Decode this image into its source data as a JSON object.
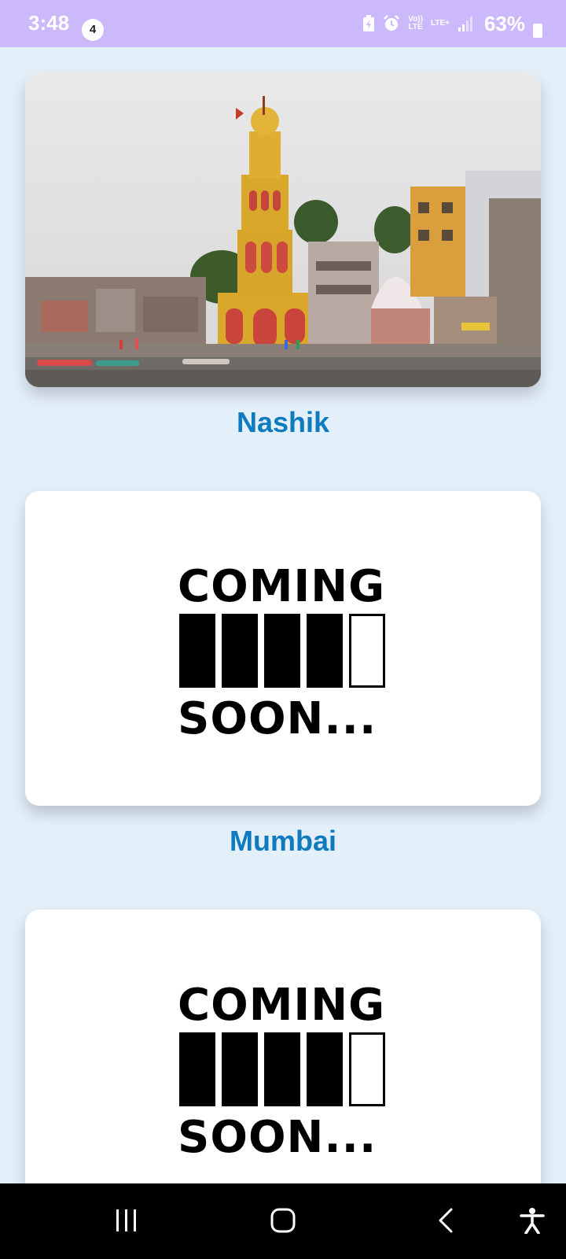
{
  "status_bar": {
    "time": "3:48",
    "notification_count": "4",
    "volte_label": "Vo))\nLTE",
    "lte_label": "LTE+",
    "battery_percent": "63%",
    "icons": [
      "battery-saver-icon",
      "alarm-icon",
      "volte-icon",
      "lte-icon",
      "signal-icon",
      "battery-icon"
    ]
  },
  "cities": [
    {
      "name": "Nashik",
      "image": "temple-riverfront-photo"
    },
    {
      "name": "Mumbai",
      "image": "coming-soon-placeholder"
    },
    {
      "name": "",
      "image": "coming-soon-placeholder"
    }
  ],
  "coming_soon": {
    "line1": "COMING",
    "line2": "SOON...",
    "filled_bars": 4,
    "total_bars": 5
  },
  "nav_bar": {
    "icons": [
      "recent-apps-icon",
      "home-icon",
      "back-icon",
      "accessibility-icon"
    ]
  },
  "colors": {
    "status_bar": "#cbb9fb",
    "background": "#e3eff9",
    "label": "#0e7bbf"
  }
}
